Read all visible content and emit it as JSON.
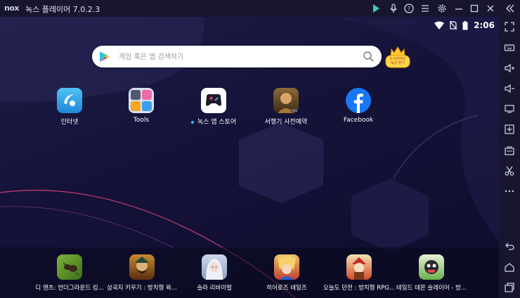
{
  "titlebar": {
    "logo": "nox",
    "title": "녹스 플레이어 7.0.2.3"
  },
  "statusbar": {
    "time": "2:06"
  },
  "search": {
    "placeholder": "게임 혹은 앱 검색하기"
  },
  "reward_badge": {
    "line1": "도서관에서",
    "line2": "보상 받기"
  },
  "desktop_apps": [
    {
      "label": "인터넷",
      "icon": "browser-icon"
    },
    {
      "label": "Tools",
      "icon": "tools-folder-icon"
    },
    {
      "label": "녹스 앱 스토어",
      "icon": "app-store-icon",
      "new_dot": true
    },
    {
      "label": "서행기 사전예약",
      "icon": "game-icon",
      "badge": "ADS"
    },
    {
      "label": "Facebook",
      "icon": "facebook-icon"
    }
  ],
  "dock_apps": [
    {
      "label": "디 앤츠: 언더그라운드 킹...",
      "icon": "ants-game-icon"
    },
    {
      "label": "삼국지 키우기 : 방치형 육...",
      "icon": "three-kingdoms-game-icon"
    },
    {
      "label": "슬라 리바이벌",
      "icon": "anime-girl-game-icon"
    },
    {
      "label": "히어로즈 테일즈",
      "icon": "heroes-game-icon"
    },
    {
      "label": "오늘도 던전 : 방치형 RPG...",
      "icon": "dungeon-game-icon"
    },
    {
      "label": "테일드 데몬 슬레이어 - 방...",
      "icon": "demon-slayer-game-icon"
    }
  ],
  "colors": {
    "titlebar": "#171530",
    "accent_dot": "#2ec4e8"
  }
}
